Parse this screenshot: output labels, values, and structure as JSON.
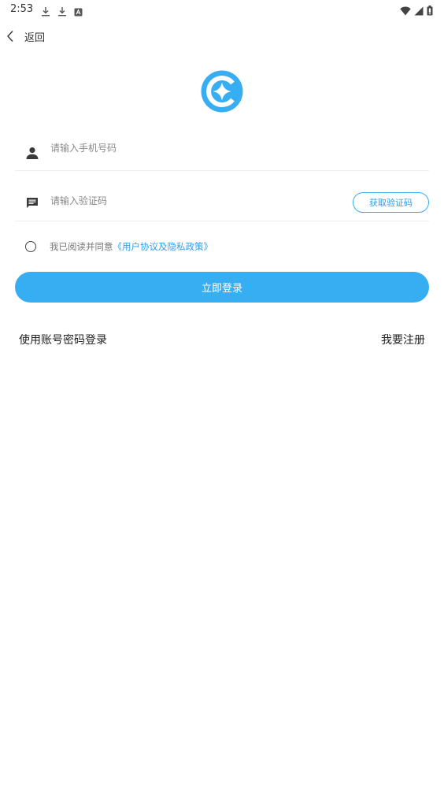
{
  "status_bar": {
    "time": "2:53",
    "left_icons": [
      "download-icon",
      "download-icon",
      "app-notification-icon"
    ],
    "right_icons": [
      "wifi-icon",
      "signal-icon",
      "battery-icon"
    ]
  },
  "nav": {
    "back_label": "返回"
  },
  "logo": {
    "icon": "app-logo-icon",
    "color": "#37aef2"
  },
  "form": {
    "phone": {
      "icon": "person-icon",
      "value": "",
      "placeholder": "请输入手机号码"
    },
    "code": {
      "icon": "message-icon",
      "value": "",
      "placeholder": "请输入验证码",
      "get_code_label": "获取验证码"
    },
    "agreement": {
      "checked": false,
      "prefix": "我已阅读并同意",
      "link": "《用户协议及隐私政策》"
    },
    "login_label": "立即登录"
  },
  "links": {
    "password_login": "使用账号密码登录",
    "register": "我要注册"
  },
  "colors": {
    "accent": "#37aef2",
    "link": "#2f9ee6"
  }
}
